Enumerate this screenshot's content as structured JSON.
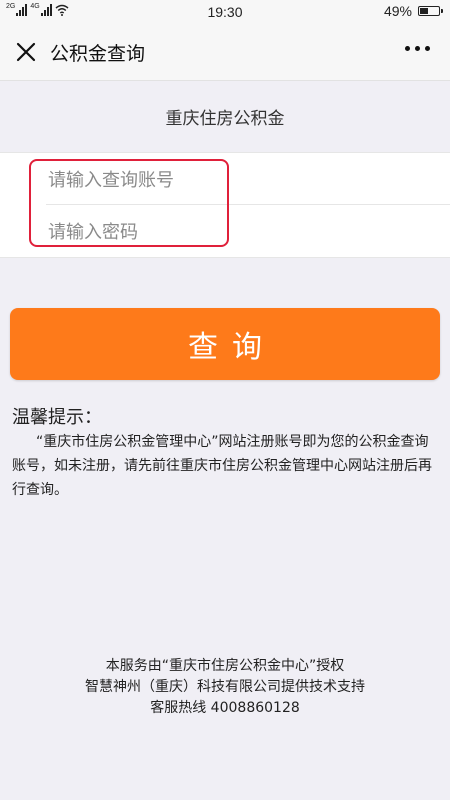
{
  "status_bar": {
    "network_1": "2G",
    "network_2": "4G",
    "time": "19:30",
    "battery": "49%",
    "battery_level": 0.49
  },
  "navbar": {
    "title": "公积金查询",
    "close_icon": "close-icon",
    "more_icon": "more-icon"
  },
  "subtitle": "重庆住房公积金",
  "form": {
    "account_placeholder": "请输入查询账号",
    "password_placeholder": "请输入密码",
    "account_value": "",
    "password_value": ""
  },
  "query_button": {
    "label": "查询",
    "color": "#fe7a1a"
  },
  "tip": {
    "title": "温馨提示：",
    "body": "“重庆市住房公积金管理中心”网站注册账号即为您的公积金查询账号，如未注册，请先前往重庆市住房公积金管理中心网站注册后再行查询。"
  },
  "footer": {
    "line1": "本服务由“重庆市住房公积金中心”授权",
    "line2": "智慧神州（重庆）科技有限公司提供技术支持",
    "line3": "客服热线 4008860128"
  },
  "highlight_color": "#e0203a"
}
